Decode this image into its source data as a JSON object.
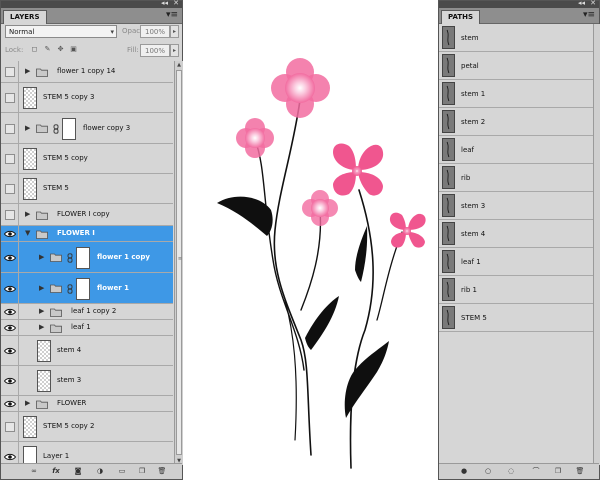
{
  "layers_panel": {
    "tab_label": "LAYERS",
    "blend_mode": "Normal",
    "opacity_label": "Opacity:",
    "opacity_value": "100%",
    "lock_label": "Lock:",
    "fill_label": "Fill:",
    "fill_value": "100%",
    "layers": [
      {
        "name": "flower 1 copy 14",
        "kind": "group",
        "visible": false,
        "selected": false
      },
      {
        "name": "STEM 5 copy 3",
        "kind": "pixel",
        "visible": false,
        "selected": false
      },
      {
        "name": "flower copy 3",
        "kind": "group-mask",
        "visible": false,
        "selected": false
      },
      {
        "name": "STEM 5 copy",
        "kind": "pixel",
        "visible": false,
        "selected": false
      },
      {
        "name": "STEM 5",
        "kind": "pixel",
        "visible": false,
        "selected": false
      },
      {
        "name": "FLOWER I copy",
        "kind": "group",
        "visible": false,
        "selected": false
      },
      {
        "name": "FLOWER I",
        "kind": "group-open",
        "visible": true,
        "selected": true
      },
      {
        "name": "flower 1 copy",
        "kind": "group-mask-nested",
        "visible": true,
        "selected": true
      },
      {
        "name": "flower 1",
        "kind": "group-mask-nested",
        "visible": true,
        "selected": true
      },
      {
        "name": "leaf 1 copy 2",
        "kind": "group-nested",
        "visible": true,
        "selected": false
      },
      {
        "name": "leaf 1",
        "kind": "group-nested",
        "visible": true,
        "selected": false
      },
      {
        "name": "stem 4",
        "kind": "pixel-nested",
        "visible": true,
        "selected": false
      },
      {
        "name": "stem 3",
        "kind": "pixel-nested",
        "visible": true,
        "selected": false
      },
      {
        "name": "FLOWER",
        "kind": "group",
        "visible": true,
        "selected": false
      },
      {
        "name": "STEM 5 copy 2",
        "kind": "pixel",
        "visible": false,
        "selected": false
      },
      {
        "name": "Layer 1",
        "kind": "white",
        "visible": true,
        "selected": false
      }
    ],
    "bottom_icons": [
      "link-icon",
      "fx-icon",
      "add-mask-icon",
      "adjustment-icon",
      "new-group-icon",
      "new-layer-icon",
      "trash-icon"
    ]
  },
  "paths_panel": {
    "tab_label": "PATHS",
    "paths": [
      "stem",
      "petal",
      "stem 1",
      "stem 2",
      "leaf",
      "rib",
      "stem 3",
      "stem 4",
      "leaf 1",
      "rib 1",
      "STEM 5"
    ],
    "bottom_icons": [
      "fill-path-icon",
      "stroke-path-icon",
      "load-selection-icon",
      "make-work-path-icon",
      "new-path-icon",
      "trash-icon"
    ]
  },
  "colors": {
    "selection_blue": "#3e98e6",
    "petal_pink": "#f26ca0",
    "panel_gray": "#d6d6d6"
  }
}
